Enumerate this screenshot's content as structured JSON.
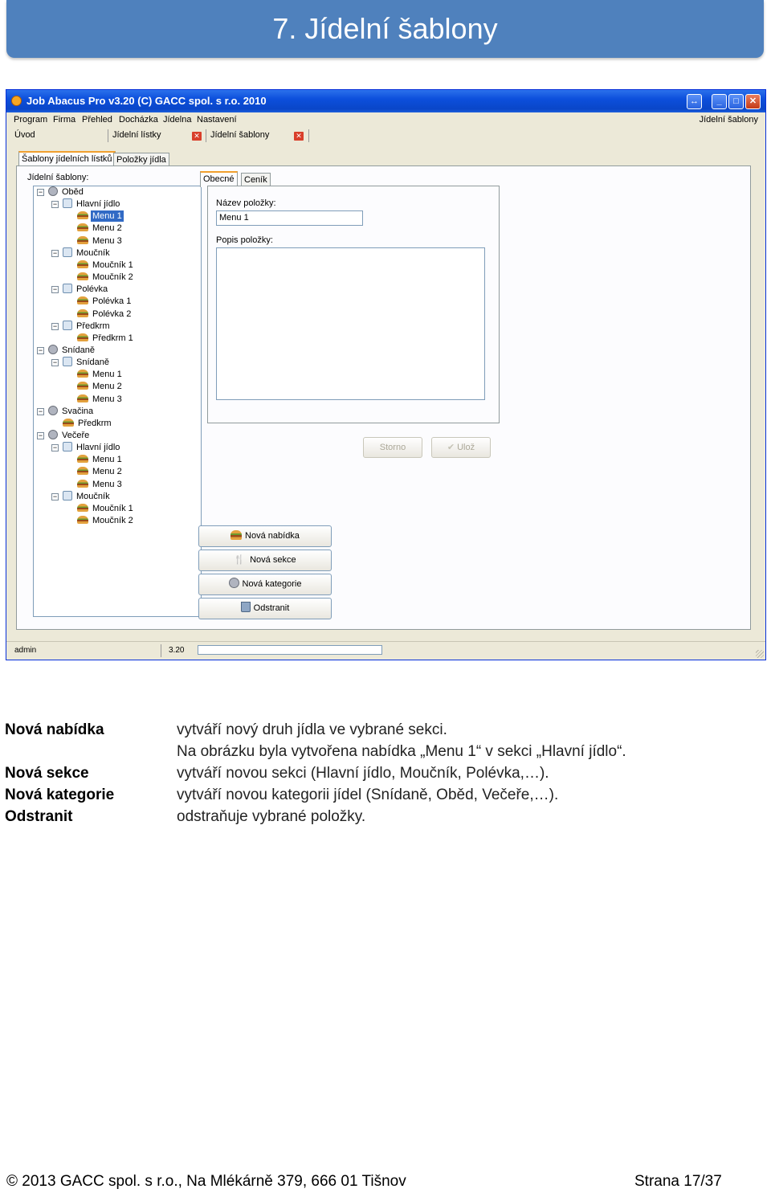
{
  "page": {
    "heading": "7. Jídelní šablony",
    "footer_left": "© 2013 GACC spol. s r.o., Na Mlékárně 379, 666 01 Tišnov",
    "footer_right": "Strana 17/37"
  },
  "window": {
    "title": "Job Abacus Pro v3.20 (C) GACC spol. s r.o. 2010",
    "menu": [
      "Program",
      "Firma",
      "Přehled",
      "Docházka",
      "Jídelna",
      "Nastavení"
    ],
    "menu_right": "Jídelní šablony",
    "doc_tabs": [
      "Úvod",
      "Jídelní lístky",
      "Jídelní šablony"
    ],
    "panel_tabs": [
      "Šablony jídelních lístků",
      "Položky jídla"
    ],
    "tree_label": "Jídelní šablony:",
    "tree": [
      {
        "label": "Oběd",
        "level": 0,
        "type": "category"
      },
      {
        "label": "Hlavní jídlo",
        "level": 1,
        "type": "section"
      },
      {
        "label": "Menu 1",
        "level": 2,
        "type": "item",
        "selected": true
      },
      {
        "label": "Menu 2",
        "level": 2,
        "type": "item"
      },
      {
        "label": "Menu 3",
        "level": 2,
        "type": "item"
      },
      {
        "label": "Moučník",
        "level": 1,
        "type": "section"
      },
      {
        "label": "Moučník 1",
        "level": 2,
        "type": "item"
      },
      {
        "label": "Moučník 2",
        "level": 2,
        "type": "item"
      },
      {
        "label": "Polévka",
        "level": 1,
        "type": "section"
      },
      {
        "label": "Polévka 1",
        "level": 2,
        "type": "item"
      },
      {
        "label": "Polévka 2",
        "level": 2,
        "type": "item"
      },
      {
        "label": "Předkrm",
        "level": 1,
        "type": "section"
      },
      {
        "label": "Předkrm 1",
        "level": 2,
        "type": "item"
      },
      {
        "label": "Snídaně",
        "level": 0,
        "type": "category"
      },
      {
        "label": "Snídaně",
        "level": 1,
        "type": "section"
      },
      {
        "label": "Menu 1",
        "level": 2,
        "type": "item"
      },
      {
        "label": "Menu 2",
        "level": 2,
        "type": "item"
      },
      {
        "label": "Menu 3",
        "level": 2,
        "type": "item"
      },
      {
        "label": "Svačina",
        "level": 0,
        "type": "category"
      },
      {
        "label": "Předkrm",
        "level": 1,
        "type": "item"
      },
      {
        "label": "Večeře",
        "level": 0,
        "type": "category"
      },
      {
        "label": "Hlavní jídlo",
        "level": 1,
        "type": "section"
      },
      {
        "label": "Menu 1",
        "level": 2,
        "type": "item"
      },
      {
        "label": "Menu 2",
        "level": 2,
        "type": "item"
      },
      {
        "label": "Menu 3",
        "level": 2,
        "type": "item"
      },
      {
        "label": "Moučník",
        "level": 1,
        "type": "section"
      },
      {
        "label": "Moučník 1",
        "level": 2,
        "type": "item"
      },
      {
        "label": "Moučník 2",
        "level": 2,
        "type": "item"
      }
    ],
    "detail": {
      "tabs": [
        "Obecné",
        "Ceník"
      ],
      "name_label": "Název položky:",
      "name_value": "Menu 1",
      "desc_label": "Popis položky:",
      "desc_value": "",
      "cancel_button": "Storno",
      "save_button": "Ulož"
    },
    "action_buttons": [
      {
        "label": "Nová nabídka",
        "icon": "burger-icon"
      },
      {
        "label": "Nová sekce",
        "icon": "cutlery-icon"
      },
      {
        "label": "Nová kategorie",
        "icon": "database-icon"
      },
      {
        "label": "Odstranit",
        "icon": "trash-icon"
      }
    ],
    "status": {
      "user": "admin",
      "version": "3.20"
    }
  },
  "descriptions": [
    {
      "term": "Nová nabídka",
      "text": "vytváří nový druh jídla ve vybrané sekci."
    },
    {
      "term": "",
      "text": "Na obrázku byla vytvořena nabídka „Menu 1“ v sekci „Hlavní jídlo“."
    },
    {
      "term": "Nová sekce",
      "text": "vytváří novou sekci (Hlavní jídlo, Moučník, Polévka,…)."
    },
    {
      "term": "Nová kategorie",
      "text": "vytváří novou kategorii jídel (Snídaně, Oběd, Večeře,…)."
    },
    {
      "term": "Odstranit",
      "text": "odstraňuje vybrané položky."
    }
  ]
}
